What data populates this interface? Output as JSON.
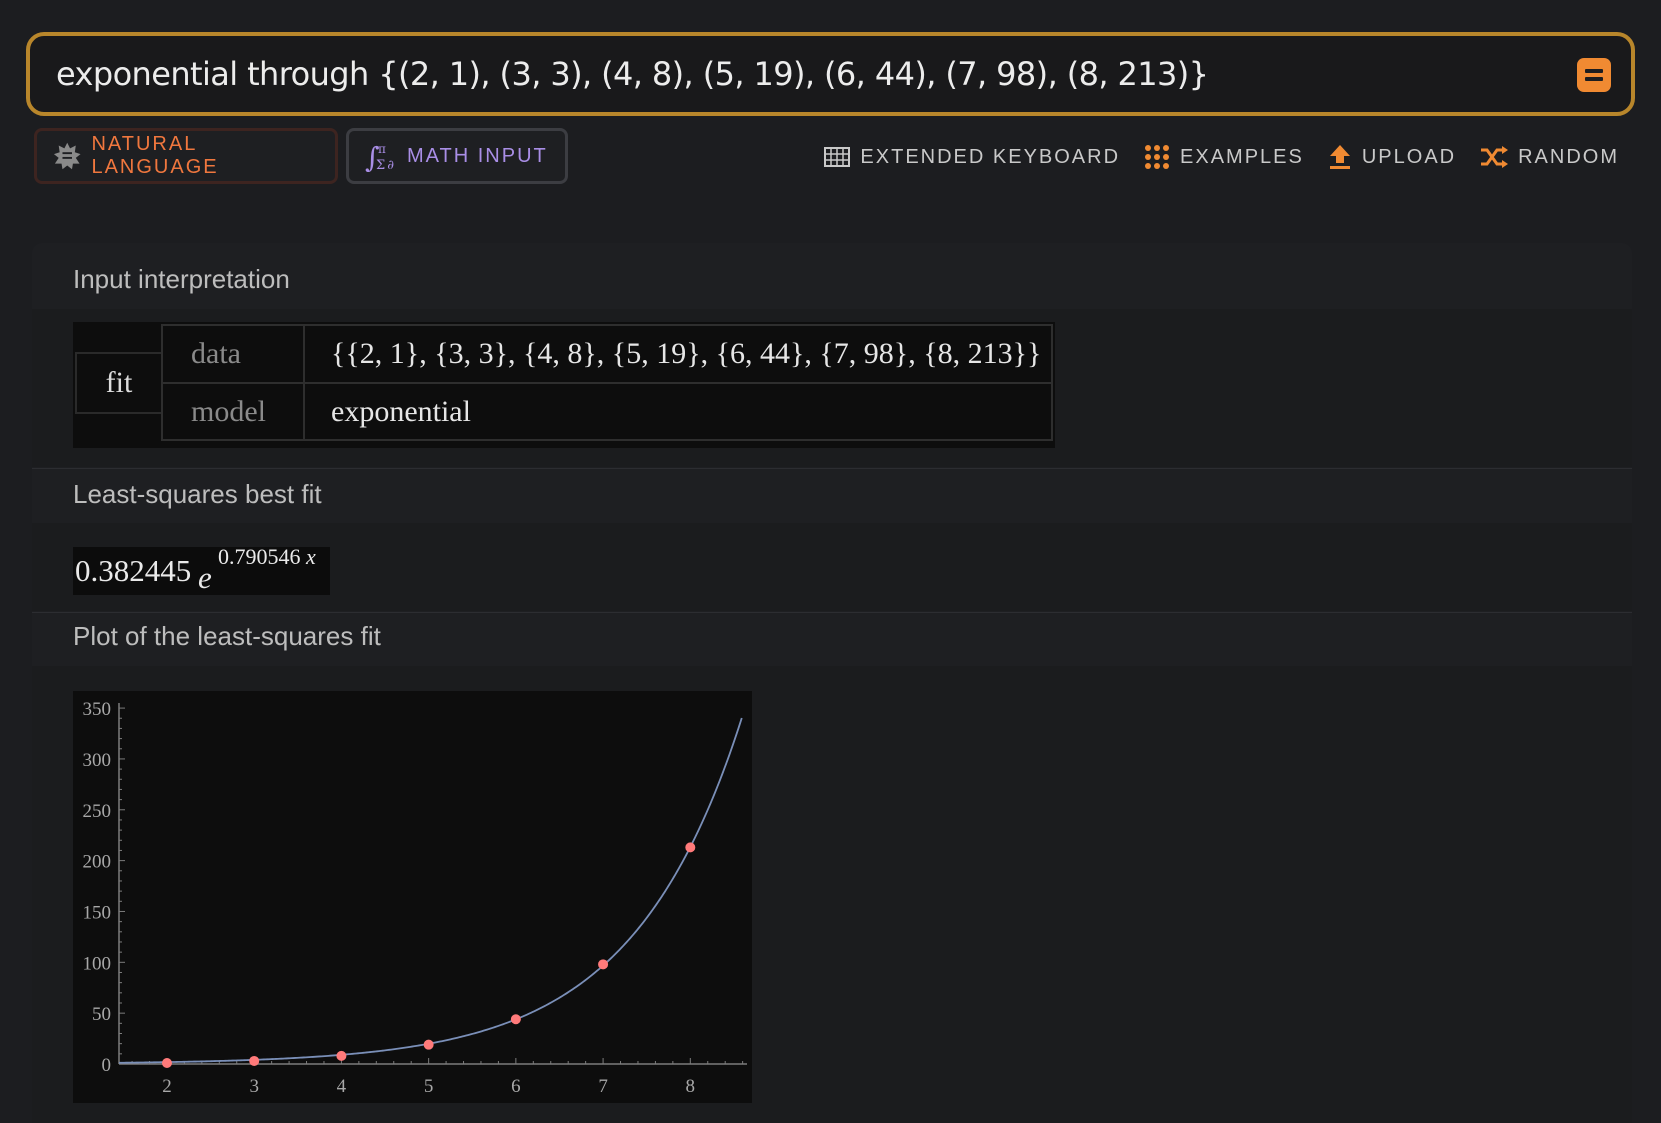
{
  "search": {
    "query": "exponential through {(2, 1), (3, 3), (4, 8), (5, 19), (6, 44), (7, 98), (8, 213)}"
  },
  "modes": {
    "natural_label": "NATURAL LANGUAGE",
    "math_label": "MATH INPUT"
  },
  "toolbar": {
    "keyboard_label": "EXTENDED KEYBOARD",
    "examples_label": "EXAMPLES",
    "upload_label": "UPLOAD",
    "random_label": "RANDOM"
  },
  "pods": {
    "interpretation": {
      "title": "Input interpretation",
      "fit_label": "fit",
      "data_label": "data",
      "data_value": "{{2, 1}, {3, 3}, {4, 8}, {5, 19}, {6, 44}, {7, 98}, {8, 213}}",
      "model_label": "model",
      "model_value": "exponential"
    },
    "best_fit": {
      "title": "Least-squares best fit",
      "coefficient": "0.382445",
      "base": "e",
      "exponent_coef": "0.790546",
      "exponent_var": "x"
    },
    "plot": {
      "title": "Plot of the least-squares fit"
    }
  },
  "colors": {
    "accent": "#f08a32",
    "point": "#ff7a7a",
    "curve": "#7a8fb8",
    "border": "#b8862b"
  },
  "chart_data": {
    "type": "scatter",
    "title": "",
    "xlabel": "",
    "ylabel": "",
    "x": [
      2,
      3,
      4,
      5,
      6,
      7,
      8
    ],
    "y": [
      1,
      3,
      8,
      19,
      44,
      98,
      213
    ],
    "fit_curve": {
      "a": 0.382445,
      "b": 0.790546,
      "model": "a*e^(b*x)"
    },
    "xlim": [
      1.45,
      8.65
    ],
    "ylim": [
      0,
      355
    ],
    "xticks": [
      2,
      3,
      4,
      5,
      6,
      7,
      8
    ],
    "yticks": [
      0,
      50,
      100,
      150,
      200,
      250,
      300,
      350
    ],
    "grid": false
  }
}
